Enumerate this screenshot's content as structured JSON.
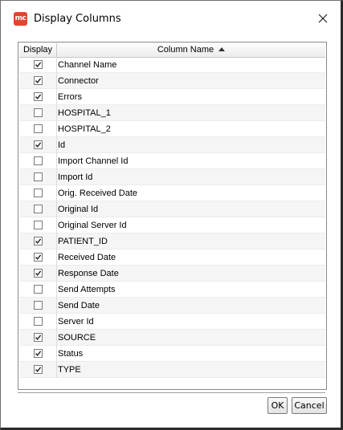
{
  "window": {
    "title": "Display Columns",
    "app_icon_text": "mc"
  },
  "table": {
    "headers": {
      "display": "Display",
      "column_name": "Column Name"
    },
    "rows": [
      {
        "name": "Channel Name",
        "checked": true
      },
      {
        "name": "Connector",
        "checked": true
      },
      {
        "name": "Errors",
        "checked": true
      },
      {
        "name": "HOSPITAL_1",
        "checked": false
      },
      {
        "name": "HOSPITAL_2",
        "checked": false
      },
      {
        "name": "Id",
        "checked": true
      },
      {
        "name": "Import Channel Id",
        "checked": false
      },
      {
        "name": "Import Id",
        "checked": false
      },
      {
        "name": "Orig. Received Date",
        "checked": false
      },
      {
        "name": "Original Id",
        "checked": false
      },
      {
        "name": "Original Server Id",
        "checked": false
      },
      {
        "name": "PATIENT_ID",
        "checked": true
      },
      {
        "name": "Received Date",
        "checked": true
      },
      {
        "name": "Response Date",
        "checked": true
      },
      {
        "name": "Send Attempts",
        "checked": false
      },
      {
        "name": "Send Date",
        "checked": false
      },
      {
        "name": "Server Id",
        "checked": false
      },
      {
        "name": "SOURCE",
        "checked": true
      },
      {
        "name": "Status",
        "checked": true
      },
      {
        "name": "TYPE",
        "checked": true
      }
    ]
  },
  "buttons": {
    "ok": "OK",
    "cancel": "Cancel"
  },
  "colors": {
    "app_icon": "#e0452f",
    "row_alt": "#f5f5f5"
  }
}
